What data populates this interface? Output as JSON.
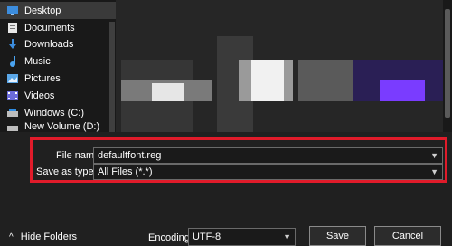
{
  "sidebar": {
    "items": [
      {
        "label": "Desktop",
        "icon": "desktop-icon",
        "selected": true
      },
      {
        "label": "Documents",
        "icon": "documents-icon"
      },
      {
        "label": "Downloads",
        "icon": "downloads-icon"
      },
      {
        "label": "Music",
        "icon": "music-icon"
      },
      {
        "label": "Pictures",
        "icon": "pictures-icon"
      },
      {
        "label": "Videos",
        "icon": "videos-icon"
      },
      {
        "label": "Windows (C:)",
        "icon": "drive-icon"
      },
      {
        "label": "New Volume (D:)",
        "icon": "drive-icon"
      }
    ]
  },
  "form": {
    "file_name_label": "File name:",
    "file_name_value": "defaultfont.reg",
    "save_type_label": "Save as type:",
    "save_type_value": "All Files  (*.*)"
  },
  "footer": {
    "hide_folders_label": "Hide Folders",
    "encoding_label": "Encoding:",
    "encoding_value": "UTF-8",
    "save_label": "Save",
    "cancel_label": "Cancel"
  },
  "colors": {
    "highlight_border": "#e01b2a",
    "accent_purple": "#7a3cff"
  }
}
